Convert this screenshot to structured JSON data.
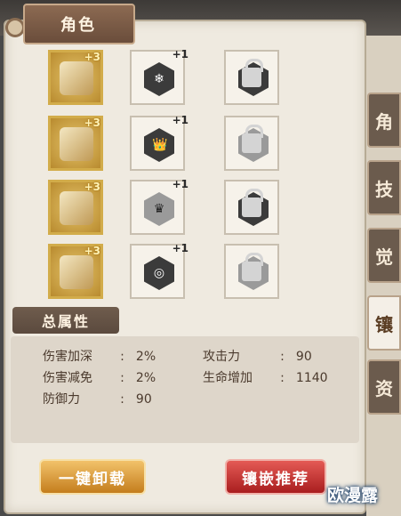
{
  "header": {
    "title": "角色"
  },
  "slots": [
    {
      "equip_plus": "+3",
      "gem_plus": "+1",
      "gem_symbol": "❄",
      "gem_style": "dark"
    },
    {
      "equip_plus": "+3",
      "gem_plus": "+1",
      "gem_symbol": "👑",
      "gem_style": "dark"
    },
    {
      "equip_plus": "+3",
      "gem_plus": "+1",
      "gem_symbol": "♛",
      "gem_style": "silver"
    },
    {
      "equip_plus": "+3",
      "gem_plus": "+1",
      "gem_symbol": "◎",
      "gem_style": "dark"
    }
  ],
  "sidebar": [
    "角",
    "技",
    "觉",
    "镶",
    "资"
  ],
  "section": {
    "title": "总属性"
  },
  "stats": {
    "left": [
      {
        "label": "伤害加深",
        "colon": ":",
        "value": "2%"
      },
      {
        "label": "伤害减免",
        "colon": ":",
        "value": "2%"
      },
      {
        "label": "防御力",
        "colon": ":",
        "value": "90"
      }
    ],
    "right": [
      {
        "label": "攻击力",
        "colon": ":",
        "value": "90"
      },
      {
        "label": "生命增加",
        "colon": ":",
        "value": "1140"
      }
    ]
  },
  "buttons": {
    "unload": "一键卸载",
    "recommend": "镶嵌推荐"
  },
  "watermark": "欧漫露",
  "colors": {
    "accent_gold": "#c47d1d",
    "accent_red": "#a91e1f",
    "panel": "#efeae0"
  }
}
